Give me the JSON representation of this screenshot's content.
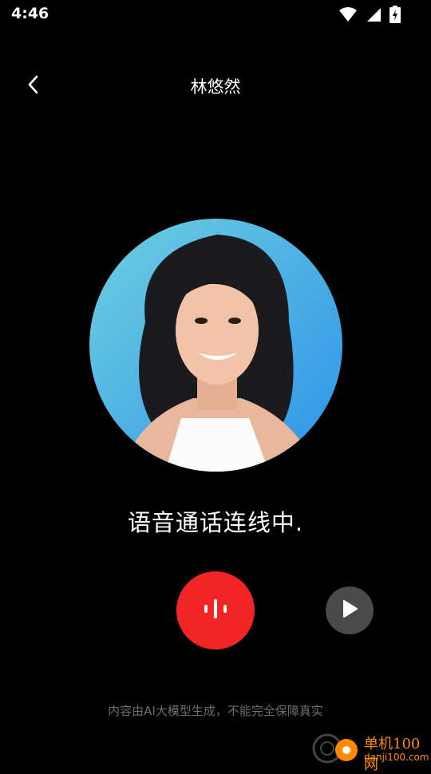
{
  "status_bar": {
    "time": "4:46"
  },
  "header": {
    "title": "林悠然"
  },
  "call": {
    "status_text": "语音通话连线中."
  },
  "footer": {
    "disclaimer": "内容由AI大模型生成，不能完全保障真实"
  },
  "watermark": {
    "name": "单机100网",
    "domain": "danji100.com"
  },
  "colors": {
    "background": "#000000",
    "mic_button": "#f32424",
    "play_button": "#4a4a4a",
    "disclaimer": "#6e6e6e",
    "watermark": "#ff8a00"
  },
  "icons": [
    "wifi-icon",
    "signal-icon",
    "battery-icon",
    "back-icon",
    "voice-wave-icon",
    "play-icon"
  ]
}
